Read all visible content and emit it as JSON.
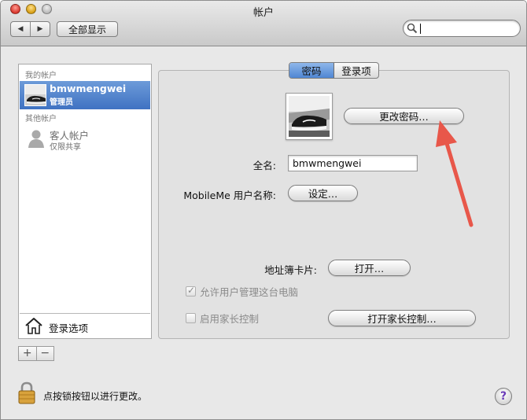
{
  "window": {
    "title": "帐户"
  },
  "toolbar": {
    "back_glyph": "◀",
    "forward_glyph": "▶",
    "show_all_label": "全部显示",
    "search_value": "",
    "search_placeholder": ""
  },
  "sidebar": {
    "my_accounts_label": "我的帐户",
    "current_user": {
      "name": "bmwmengwei",
      "role": "管理员"
    },
    "other_accounts_label": "其他帐户",
    "guest": {
      "name": "客人帐户",
      "status": "仅限共享"
    },
    "login_options_label": "登录选项",
    "add_label": "+",
    "remove_label": "−"
  },
  "tabs": {
    "password_label": "密码",
    "login_items_label": "登录项",
    "active": "password"
  },
  "account": {
    "change_password_label": "更改密码…",
    "full_name_label": "全名:",
    "full_name_value": "bmwmengwei",
    "mobileme_label": "MobileMe 用户名称:",
    "mobileme_button": "设定…",
    "address_card_label": "地址簿卡片:",
    "open_button": "打开…",
    "allow_admin_label": "允许用户管理这台电脑",
    "allow_admin_checked": true,
    "parental_controls_label": "启用家长控制",
    "parental_controls_checked": false,
    "open_parental_controls_label": "打开家长控制…"
  },
  "footer": {
    "lock_text": "点按锁按钮以进行更改。",
    "help_glyph": "?"
  },
  "colors": {
    "selection": "#3f72c2",
    "arrow": "#e8574a",
    "help_mark": "#6a3ab8"
  }
}
